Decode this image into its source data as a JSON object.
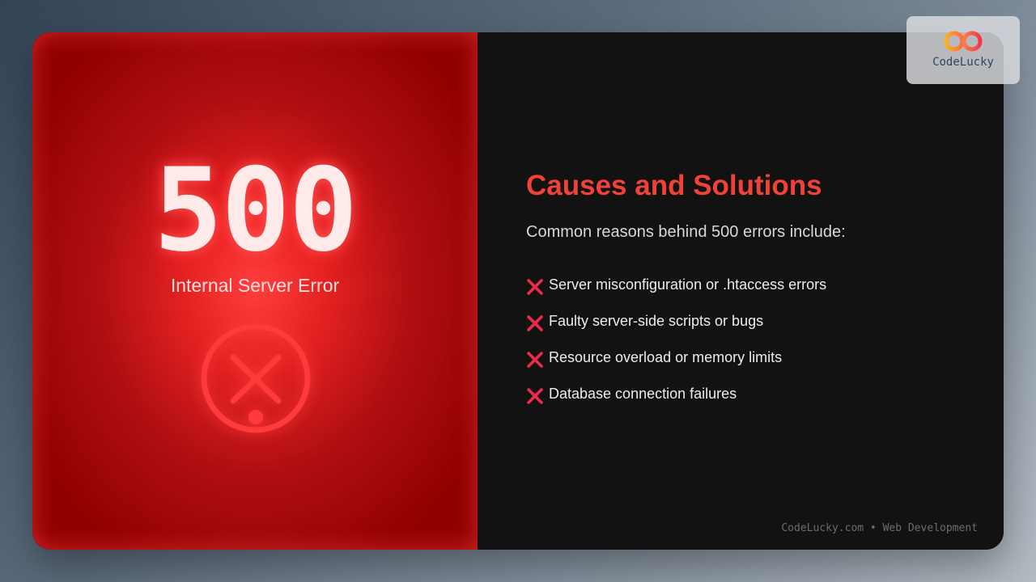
{
  "error": {
    "code": "500",
    "label": "Internal Server Error"
  },
  "content": {
    "heading": "Causes and Solutions",
    "intro": "Common reasons behind 500 errors include:",
    "causes": [
      "Server misconfiguration or .htaccess errors",
      "Faulty server-side scripts or bugs",
      "Resource overload or memory limits",
      "Database connection failures"
    ]
  },
  "footer": {
    "text": "CodeLucky.com • Web Development"
  },
  "logo": {
    "text": "CodeLucky"
  },
  "icons": {
    "error": "circle-x-icon",
    "cause_marker": "cross-mark-icon",
    "logo": "infinity-logo-icon"
  },
  "colors": {
    "accent_red": "#f04238",
    "panel_red": "#b00f12",
    "marker_red": "#ee2b4c",
    "dark_bg": "#121212"
  }
}
